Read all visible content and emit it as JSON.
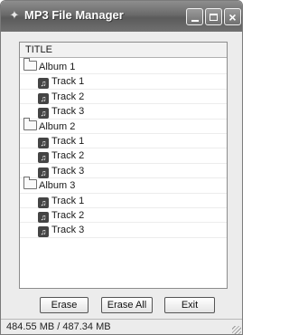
{
  "window": {
    "title": "MP3 File Manager"
  },
  "list": {
    "column_title": "TITLE",
    "albums": [
      {
        "name": "Album 1",
        "tracks": [
          "Track 1",
          "Track 2",
          "Track 3"
        ]
      },
      {
        "name": "Album 2",
        "tracks": [
          "Track 1",
          "Track 2",
          "Track 3"
        ]
      },
      {
        "name": "Album 3",
        "tracks": [
          "Track 1",
          "Track 2",
          "Track 3"
        ]
      }
    ]
  },
  "buttons": {
    "erase": "Erase",
    "erase_all": "Erase All",
    "exit": "Exit"
  },
  "status": {
    "text": "484.55 MB / 487.34 MB"
  }
}
